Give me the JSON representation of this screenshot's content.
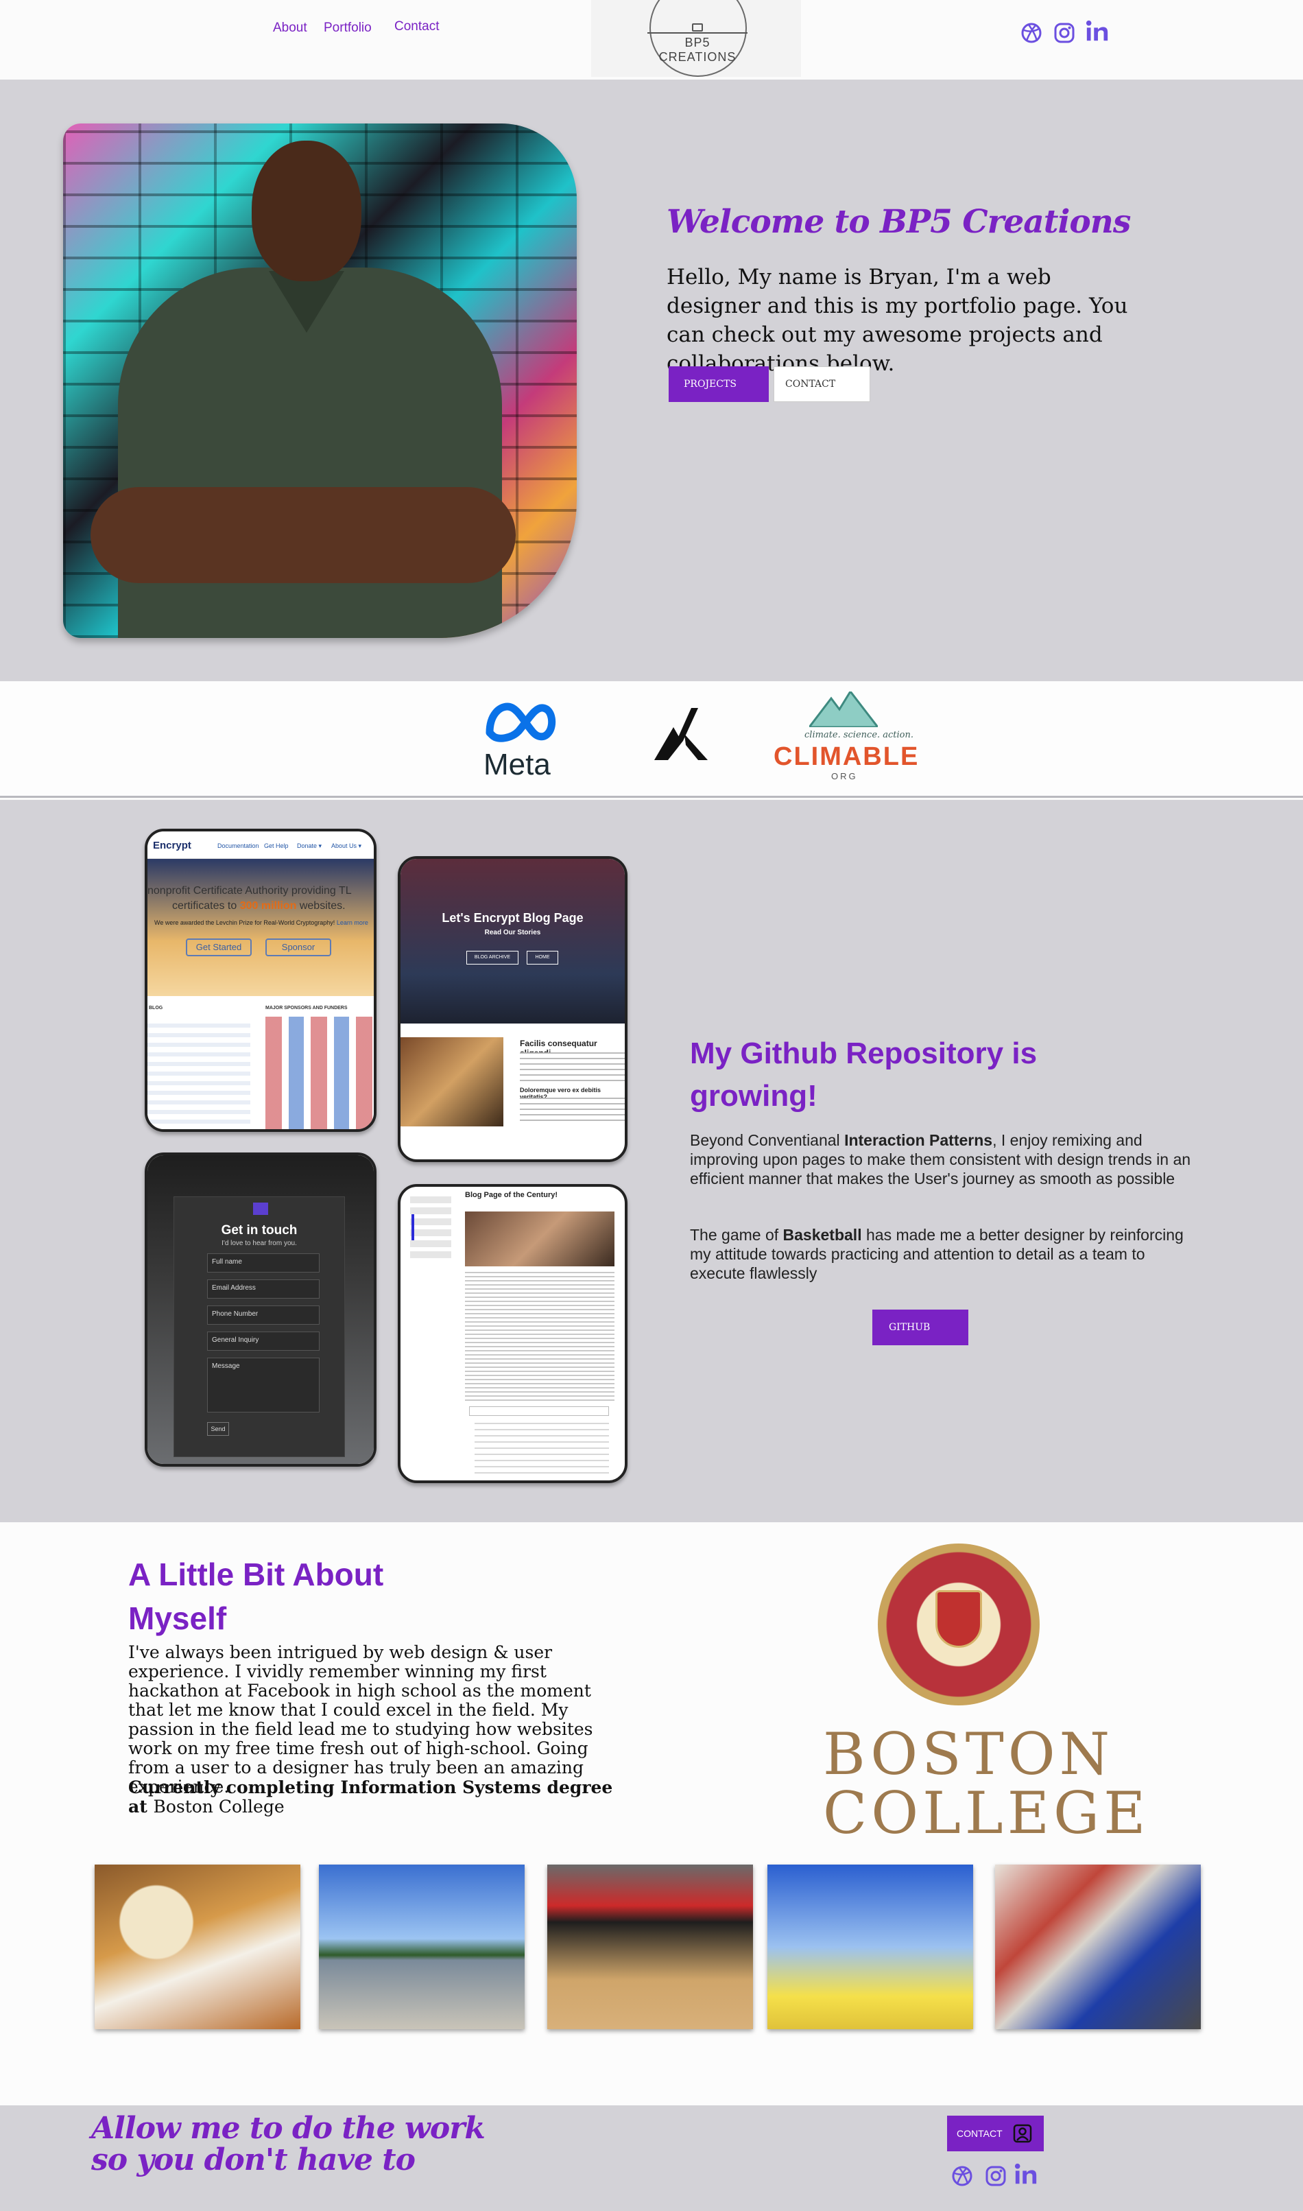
{
  "header": {
    "nav": [
      {
        "label": "About"
      },
      {
        "label": "Portfolio"
      },
      {
        "label": "Contact"
      }
    ],
    "logo_text": "BP5 CREATIONS",
    "social_icons": [
      "dribbble-icon",
      "instagram-icon",
      "linkedin-icon"
    ]
  },
  "hero": {
    "title": "Welcome to BP5 Creations",
    "text": "Hello, My name is Bryan, I'm a web designer and this is my portfolio page. You can check out my awesome projects and collaborations below.",
    "projects_button": "PROJECTS",
    "contact_button": "CONTACT"
  },
  "partners": {
    "meta": "Meta",
    "climable_tagline": "climate. science. action.",
    "climable": "CLIMABLE",
    "climable_org": "ORG"
  },
  "mockups": {
    "encrypt": {
      "brand": "Encrypt",
      "nav": [
        "Documentation",
        "Get Help",
        "Donate ▾",
        "About Us ▾"
      ],
      "headline": "nonprofit Certificate Authority providing TL",
      "headline2a": "certificates to ",
      "headline2b": "300 million",
      "headline2c": " websites.",
      "sub": "We were awarded the Levchin Prize for Real-World Cryptography!",
      "sub_link": "Learn more",
      "btn_start": "Get Started",
      "btn_sponsor": "Sponsor",
      "blog_label": "BLOG",
      "sponsors_label": "MAJOR SPONSORS AND FUNDERS"
    },
    "blog": {
      "title": "Let's Encrypt Blog Page",
      "subtitle": "Read Our Stories",
      "btn_archive": "BLOG ARCHIVE",
      "btn_home": "HOME",
      "post_title": "Facilis consequatur eligendi",
      "post_sub": "Doloremque vero ex debitis veritatis?"
    },
    "contact": {
      "title": "Get in touch",
      "subtitle": "I'd love to hear from you.",
      "fields": [
        "Full name",
        "Email Address",
        "Phone Number",
        "General Inquiry",
        "Message"
      ],
      "send": "Send"
    },
    "article": {
      "title": "Blog Page of the Century!"
    }
  },
  "github": {
    "title": "My Github Repository is growing!",
    "p1_a": "Beyond Conventianal ",
    "p1_bold": "Interaction Patterns",
    "p1_b": ", I enjoy remixing and improving upon pages to make them consistent with design trends in an efficient manner that makes the User's journey as smooth as possible",
    "p2_a": "The game of ",
    "p2_bold": "Basketball",
    "p2_b": " has made me a better designer by reinforcing my attitude towards practicing and attention to detail as a team to execute flawlessly",
    "button": "GITHUB"
  },
  "about": {
    "title": "A Little Bit About Myself",
    "text": "I've always been intrigued by web design & user experience. I vividly remember winning my first hackathon at Facebook in high school as the moment that let me know that I could excel in the field. My passion in the field lead me to studying how websites work on my free time fresh out of high-school. Going from a user to a designer has truly been an amazing experience.",
    "degree_bold": "Currently completing Information Systems degree at ",
    "degree_school": "Boston College",
    "bc_line1": "BOSTON",
    "bc_line2": "COLLEGE"
  },
  "footer": {
    "tagline": "Allow me to do the work so you don't have to",
    "contact_button": "CONTACT",
    "social_icons": [
      "dribbble-icon",
      "instagram-icon",
      "linkedin-icon"
    ]
  },
  "colors": {
    "accent": "#7a22c4",
    "social": "#6b4fe0",
    "section_gray": "#d3d2d7"
  }
}
